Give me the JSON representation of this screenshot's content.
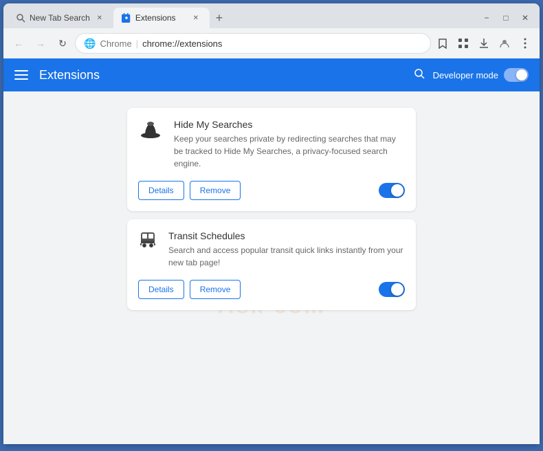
{
  "browser": {
    "tabs": [
      {
        "id": "tab-1",
        "label": "New Tab Search",
        "icon": "🔍",
        "active": false,
        "closeable": true
      },
      {
        "id": "tab-2",
        "label": "Extensions",
        "icon": "🧩",
        "active": true,
        "closeable": true
      }
    ],
    "new_tab_label": "+",
    "window_controls": {
      "minimize": "−",
      "maximize": "□",
      "close": "✕"
    },
    "address_bar": {
      "protocol": "chrome",
      "separator": "|",
      "url": "chrome://extensions",
      "globe_icon": "🌐"
    }
  },
  "header": {
    "menu_icon": "☰",
    "title": "Extensions",
    "search_icon": "🔍",
    "developer_mode_label": "Developer mode",
    "toggle_on": true
  },
  "extensions": [
    {
      "id": "hide-my-searches",
      "name": "Hide My Searches",
      "description": "Keep your searches private by redirecting searches that may be tracked to Hide My Searches, a privacy-focused search engine.",
      "icon_type": "hat",
      "enabled": true,
      "details_label": "Details",
      "remove_label": "Remove"
    },
    {
      "id": "transit-schedules",
      "name": "Transit Schedules",
      "description": "Search and access popular transit quick links instantly from your new tab page!",
      "icon_type": "bus",
      "enabled": true,
      "details_label": "Details",
      "remove_label": "Remove"
    }
  ],
  "watermark": {
    "line1": "risk-com",
    "line2": ""
  }
}
